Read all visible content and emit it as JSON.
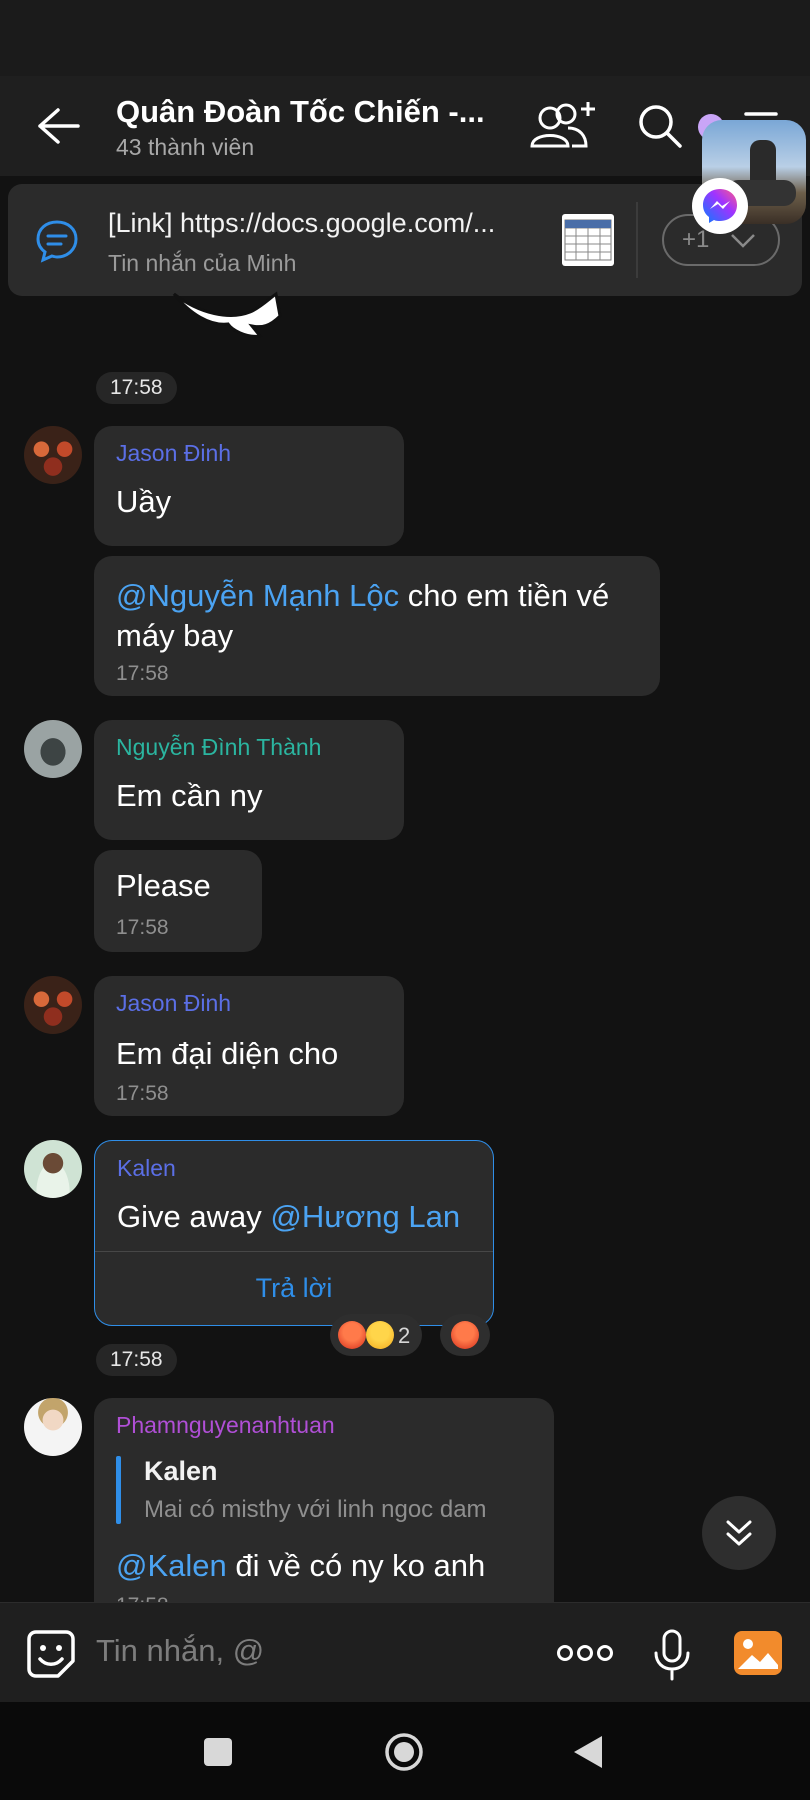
{
  "header": {
    "title": "Quân Đoàn Tốc Chiến -...",
    "subtitle": "43 thành viên",
    "icons": [
      "back-arrow-icon",
      "add-member-icon",
      "search-icon",
      "menu-icon"
    ]
  },
  "pinned": {
    "title": "[Link] https://docs.google.com/...",
    "subtitle": "Tin nhắn của Minh",
    "more_count": "+1"
  },
  "colors": {
    "mention": "#4ba3f2",
    "sender_blue": "#5b6fe6",
    "sender_teal": "#2bb5a0",
    "sender_purple": "#b04fd6",
    "reply_blue": "#2f8ee8"
  },
  "messages": [
    {
      "time_chip": "17:58"
    },
    {
      "sender": "Jason Đinh",
      "text": "Uầy"
    },
    {
      "mention": "@Nguyễn Mạnh Lộc",
      "text_line1": " cho em tiền vé",
      "text_line2": "máy bay",
      "time": "17:58"
    },
    {
      "sender": "Nguyễn Đình Thành",
      "text": "Em cần ny"
    },
    {
      "text": "Please",
      "time": "17:58"
    },
    {
      "sender": "Jason Đinh",
      "text": "Em đại diện cho",
      "time": "17:58"
    },
    {
      "sender": "Kalen",
      "text": "Give away ",
      "mention": "@Hương Lan",
      "reply_label": "Trả lời",
      "reactions_count": "2"
    },
    {
      "time_chip": "17:58"
    },
    {
      "sender": "Phamnguyenanhtuan",
      "quote_author": "Kalen",
      "quote_text": "Mai có misthy với linh ngoc dam",
      "mention": "@Kalen",
      "text": " đi về có ny ko anh",
      "time": "17:58"
    }
  ],
  "input": {
    "placeholder": "Tin nhắn, @"
  },
  "navbar": {
    "icons": [
      "recents-icon",
      "home-icon",
      "back-icon"
    ]
  }
}
